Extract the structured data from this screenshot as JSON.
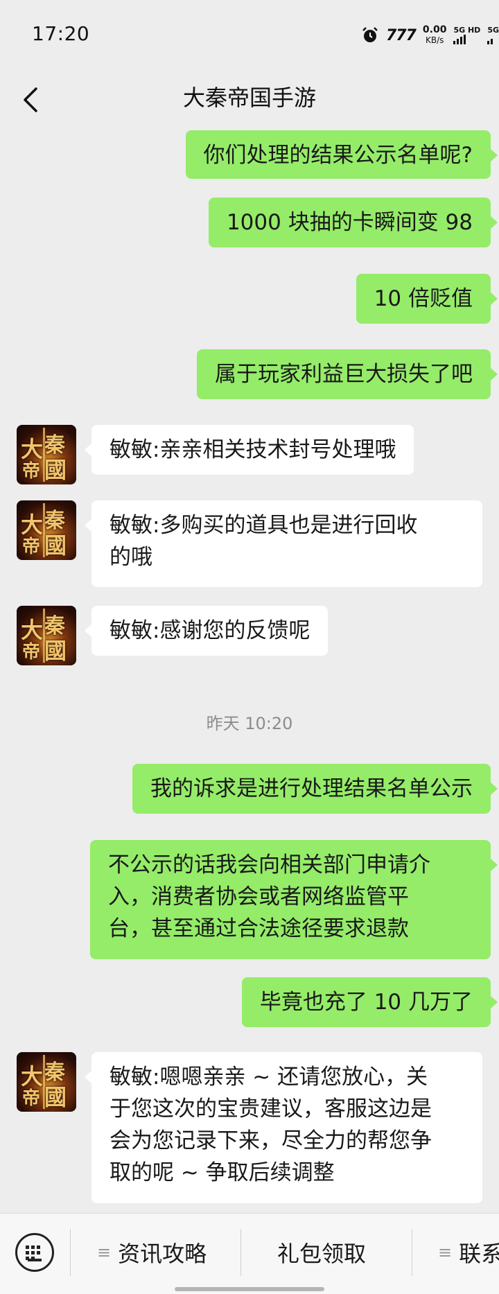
{
  "status_bar": {
    "time": "17:20",
    "brand": "777",
    "speed_value": "0.00",
    "speed_unit": "KB/s",
    "net_label_1": "5G HD",
    "net_label_2": "5G"
  },
  "header": {
    "title": "大秦帝国手游"
  },
  "messages": [
    {
      "side": "me",
      "text": "你们处理的结果公示名单呢?"
    },
    {
      "side": "me",
      "text": "1000 块抽的卡瞬间变 98"
    },
    {
      "side": "me",
      "text": "10 倍贬值"
    },
    {
      "side": "me",
      "text": "属于玩家利益巨大损失了吧"
    },
    {
      "side": "them",
      "text": "敏敏:亲亲相关技术封号处理哦"
    },
    {
      "side": "them",
      "text": "敏敏:多购买的道具也是进行回收\n的哦"
    },
    {
      "side": "them",
      "text": "敏敏:感谢您的反馈呢"
    },
    {
      "side": "me",
      "text": "我的诉求是进行处理结果名单公示"
    },
    {
      "side": "me",
      "text": "不公示的话我会向相关部门申请介\n入，消费者协会或者网络监管平\n台，甚至通过合法途径要求退款"
    },
    {
      "side": "me",
      "text": "毕竟也充了 10 几万了"
    },
    {
      "side": "them",
      "text": "敏敏:嗯嗯亲亲 ~ 还请您放心，关\n于您这次的宝贵建议，客服这边是\n会为您记录下来，尽全力的帮您争\n取的呢 ~ 争取后续调整"
    }
  ],
  "timestamp": "昨天 10:20",
  "avatar": {
    "glyphs": [
      "大",
      "秦",
      "國",
      "帝"
    ]
  },
  "bottom_menu": {
    "items": [
      {
        "label": "资讯攻略",
        "icon": "≡"
      },
      {
        "label": "礼包领取",
        "icon": ""
      },
      {
        "label": "联系",
        "icon": "≡"
      }
    ]
  },
  "colors": {
    "self_bubble": "#95ec69",
    "other_bubble": "#ffffff",
    "background": "#ededed"
  }
}
